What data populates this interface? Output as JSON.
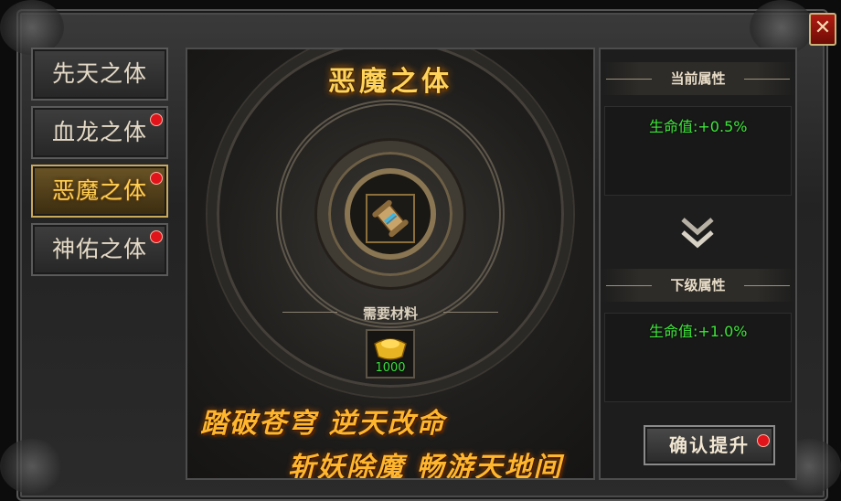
{
  "window": {
    "close_icon": "close-x-icon",
    "close_glyph": "✕"
  },
  "tabs": [
    {
      "label": "先天之体",
      "active": false,
      "has_alert": false
    },
    {
      "label": "血龙之体",
      "active": false,
      "has_alert": true
    },
    {
      "label": "恶魔之体",
      "active": true,
      "has_alert": true
    },
    {
      "label": "神佑之体",
      "active": false,
      "has_alert": true
    }
  ],
  "center": {
    "title": "恶魔之体",
    "item_icon": "scroll-icon",
    "materials_label": "需要材料",
    "material": {
      "icon": "gold-ingot-icon",
      "count": "1000"
    },
    "slogan_line1": "踏破苍穹  逆天改命",
    "slogan_line2": "斩妖除魔  畅游天地间"
  },
  "right": {
    "current_header": "当前属性",
    "current_attr": "生命值:+0.5%",
    "next_header": "下级属性",
    "next_attr": "生命值:+1.0%",
    "arrow_icon": "double-chevron-down-icon"
  },
  "confirm": {
    "label": "确认提升",
    "has_alert": true
  },
  "colors": {
    "accent_gold": "#ffcf52",
    "attr_green": "#3ee63a",
    "alert_red": "#e0141a"
  }
}
